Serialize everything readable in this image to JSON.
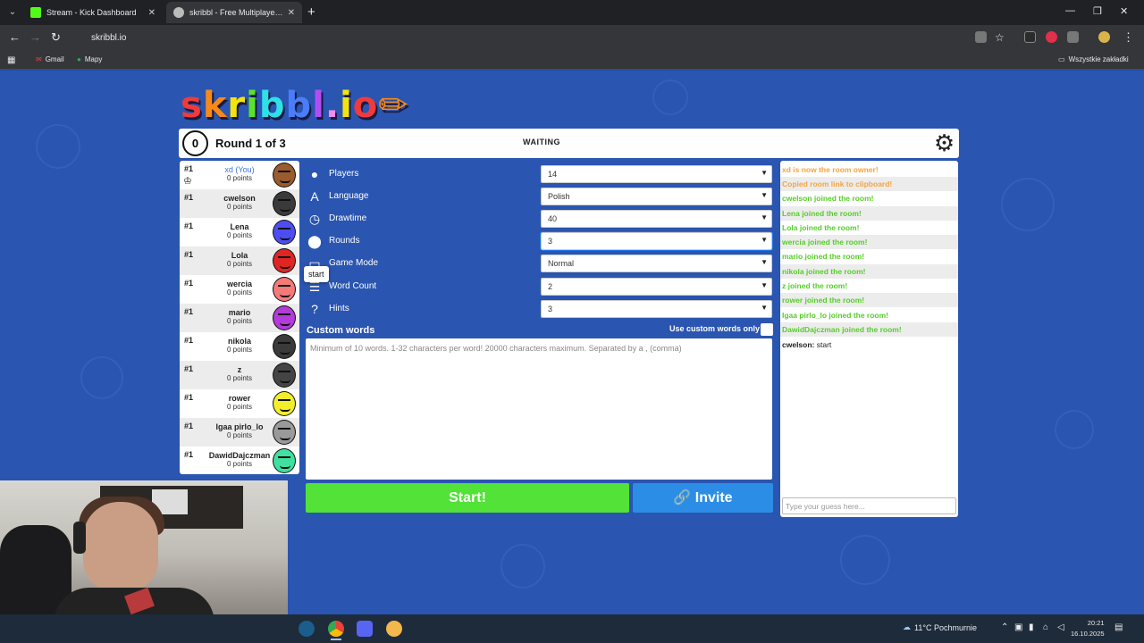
{
  "browser": {
    "tabs": [
      {
        "title": "Stream - Kick Dashboard",
        "favicon_color": "#53fc18"
      },
      {
        "title": "skribbl - Free Multiplayer Drawi",
        "favicon_color": "#bbbbbb"
      }
    ],
    "url": "skribbl.io",
    "bookmarks": [
      "Gmail",
      "Mapy"
    ],
    "all_bookmarks": "Wszystkie zakładki"
  },
  "game": {
    "logo": "skribbl.io",
    "timer": "0",
    "round": "Round 1 of 3",
    "status": "WAITING",
    "tooltip": "start"
  },
  "players": [
    {
      "rank": "#1",
      "name": "xd (You)",
      "points": "0 points",
      "color": "#9a5b2e",
      "me": true
    },
    {
      "rank": "#1",
      "name": "cwelson",
      "points": "0 points",
      "color": "#3a3a3a"
    },
    {
      "rank": "#1",
      "name": "Lena",
      "points": "0 points",
      "color": "#4d4df2"
    },
    {
      "rank": "#1",
      "name": "Lola",
      "points": "0 points",
      "color": "#e02525"
    },
    {
      "rank": "#1",
      "name": "wercia",
      "points": "0 points",
      "color": "#f47a7a"
    },
    {
      "rank": "#1",
      "name": "mario",
      "points": "0 points",
      "color": "#b23bd9"
    },
    {
      "rank": "#1",
      "name": "nikola",
      "points": "0 points",
      "color": "#3a3a3a"
    },
    {
      "rank": "#1",
      "name": "z",
      "points": "0 points",
      "color": "#444444"
    },
    {
      "rank": "#1",
      "name": "rower",
      "points": "0 points",
      "color": "#f2ee2a"
    },
    {
      "rank": "#1",
      "name": "Igaa pirlo_lo",
      "points": "0 points",
      "color": "#9a9a9a"
    },
    {
      "rank": "#1",
      "name": "DawidDajczman",
      "points": "0 points",
      "color": "#3fe0a0"
    }
  ],
  "settings": [
    {
      "label": "Players",
      "value": "14",
      "icon": "person-icon"
    },
    {
      "label": "Language",
      "value": "Polish",
      "icon": "language-icon"
    },
    {
      "label": "Drawtime",
      "value": "40",
      "icon": "clock-icon"
    },
    {
      "label": "Rounds",
      "value": "3",
      "icon": "rounds-icon"
    },
    {
      "label": "Game Mode",
      "value": "Normal",
      "icon": "gamemode-icon"
    },
    {
      "label": "Word Count",
      "value": "2",
      "icon": "wordcount-icon"
    },
    {
      "label": "Hints",
      "value": "3",
      "icon": "hints-icon"
    }
  ],
  "custom_words": {
    "title": "Custom words",
    "only_label": "Use custom words only",
    "placeholder": "Minimum of 10 words. 1-32 characters per word! 20000 characters maximum. Separated by a , (comma)"
  },
  "buttons": {
    "start": "Start!",
    "invite": "🔗 Invite"
  },
  "chat": {
    "messages": [
      {
        "text": "xd is now the room owner!",
        "color": "#f7a33c"
      },
      {
        "text": "Copied room link to clipboard!",
        "color": "#f7a33c"
      },
      {
        "text": "cwelson joined the room!",
        "color": "#56ce27"
      },
      {
        "text": "Lena joined the room!",
        "color": "#56ce27"
      },
      {
        "text": "Lola joined the room!",
        "color": "#56ce27"
      },
      {
        "text": "wercia joined the room!",
        "color": "#56ce27"
      },
      {
        "text": "mario joined the room!",
        "color": "#56ce27"
      },
      {
        "text": "nikola joined the room!",
        "color": "#56ce27"
      },
      {
        "text": "z joined the room!",
        "color": "#56ce27"
      },
      {
        "text": "rower joined the room!",
        "color": "#56ce27"
      },
      {
        "text": "Igaa pirlo_lo joined the room!",
        "color": "#56ce27"
      },
      {
        "text": "DawidDajczman joined the room!",
        "color": "#56ce27"
      }
    ],
    "last_user": "cwelson:",
    "last_text": "start",
    "input_placeholder": "Type your guess here..."
  },
  "taskbar": {
    "weather": "11°C Pochmurnie",
    "time": "20:21",
    "date": "16.10.2025"
  }
}
